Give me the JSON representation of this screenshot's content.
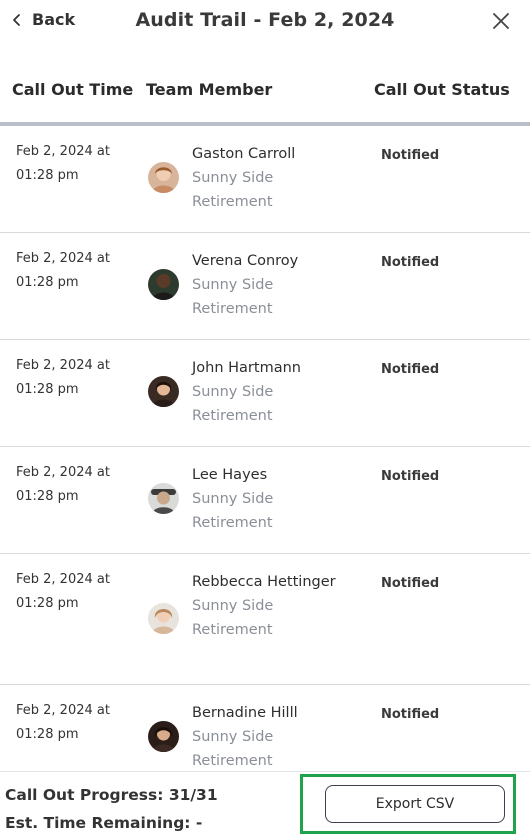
{
  "header": {
    "back_label": "Back",
    "title": "Audit Trail - Feb 2, 2024"
  },
  "columns": {
    "time": "Call Out Time",
    "member": "Team Member",
    "status": "Call Out Status"
  },
  "rows": [
    {
      "time_line1": "Feb 2, 2024 at",
      "time_line2": "01:28 pm",
      "name": "Gaston Carroll",
      "org_line1": "Sunny Side",
      "org_line2": "Retirement",
      "status": "Notified"
    },
    {
      "time_line1": "Feb 2, 2024 at",
      "time_line2": "01:28 pm",
      "name": "Verena Conroy",
      "org_line1": "Sunny Side",
      "org_line2": "Retirement",
      "status": "Notified"
    },
    {
      "time_line1": "Feb 2, 2024 at",
      "time_line2": "01:28 pm",
      "name": "John Hartmann",
      "org_line1": "Sunny Side",
      "org_line2": "Retirement",
      "status": "Notified"
    },
    {
      "time_line1": "Feb 2, 2024 at",
      "time_line2": "01:28 pm",
      "name": "Lee Hayes",
      "org_line1": "Sunny Side",
      "org_line2": "Retirement",
      "status": "Notified"
    },
    {
      "time_line1": "Feb 2, 2024 at",
      "time_line2": "01:28 pm",
      "name": "Rebbecca Hettinger",
      "org_line1": "Sunny Side",
      "org_line2": "Retirement",
      "status": "Notified"
    },
    {
      "time_line1": "Feb 2, 2024 at",
      "time_line2": "01:28 pm",
      "name": "Bernadine Hilll",
      "org_line1": "Sunny Side",
      "org_line2": "Retirement",
      "status": "Notified"
    }
  ],
  "footer": {
    "progress": "Call Out Progress: 31/31",
    "remaining": "Est. Time Remaining: -",
    "export_label": "Export CSV"
  },
  "colors": {
    "highlight": "#1fa24a",
    "org_text": "#8a8f97",
    "header_rule": "#b9bec8"
  },
  "icons": {
    "back": "chevron-left-icon",
    "close": "close-icon"
  }
}
